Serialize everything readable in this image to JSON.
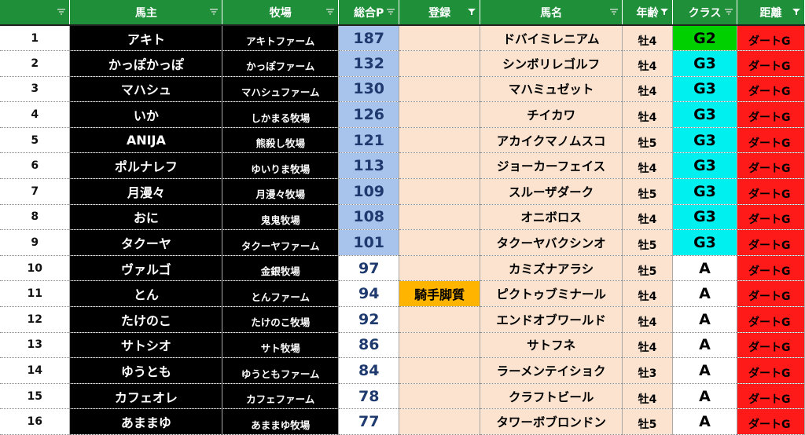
{
  "headers": [
    {
      "label": "",
      "filter": "funnel-plain"
    },
    {
      "label": "馬主",
      "filter": "funnel-plain"
    },
    {
      "label": "牧場",
      "filter": "funnel-plain"
    },
    {
      "label": "総合P",
      "filter": "funnel-plain"
    },
    {
      "label": "登録",
      "filter": "funnel-active"
    },
    {
      "label": "馬名",
      "filter": "funnel-plain"
    },
    {
      "label": "年齢",
      "filter": "funnel-active"
    },
    {
      "label": "クラス",
      "filter": "funnel-plain"
    },
    {
      "label": "距離",
      "filter": "funnel-active"
    }
  ],
  "colors": {
    "header": "#1f8f3a",
    "owner_bg": "#000000",
    "points_highlight": "#a9c4ec",
    "peach": "#fbe3cf",
    "g2": "#00d000",
    "g3": "#00f0f0",
    "dist": "#ff1a1a",
    "jockey": "#ffb400"
  },
  "rows": [
    {
      "num": "1",
      "owner": "アキト",
      "farm": "アキトファーム",
      "points": "187",
      "reg": "",
      "horse": "ドバイミレニアム",
      "age": "牡4",
      "cls": "G2",
      "dist": "ダートG"
    },
    {
      "num": "2",
      "owner": "かっぽかっぽ",
      "farm": "かっぽファーム",
      "points": "132",
      "reg": "",
      "horse": "シンボリレゴルフ",
      "age": "牡4",
      "cls": "G3",
      "dist": "ダートG"
    },
    {
      "num": "3",
      "owner": "マハシュ",
      "farm": "マハシュファーム",
      "points": "130",
      "reg": "",
      "horse": "マハミュゼット",
      "age": "牡4",
      "cls": "G3",
      "dist": "ダートG"
    },
    {
      "num": "4",
      "owner": "いか",
      "farm": "しかまる牧場",
      "points": "126",
      "reg": "",
      "horse": "チイカワ",
      "age": "牡4",
      "cls": "G3",
      "dist": "ダートG"
    },
    {
      "num": "5",
      "owner": "ANIJA",
      "farm": "熊殺し牧場",
      "points": "121",
      "reg": "",
      "horse": "アカイクマノムスコ",
      "age": "牡5",
      "cls": "G3",
      "dist": "ダートG"
    },
    {
      "num": "6",
      "owner": "ポルナレフ",
      "farm": "ゆいりま牧場",
      "points": "113",
      "reg": "",
      "horse": "ジョーカーフェイス",
      "age": "牡4",
      "cls": "G3",
      "dist": "ダートG"
    },
    {
      "num": "7",
      "owner": "月漫々",
      "farm": "月漫々牧場",
      "points": "109",
      "reg": "",
      "horse": "スルーザダーク",
      "age": "牡5",
      "cls": "G3",
      "dist": "ダートG"
    },
    {
      "num": "8",
      "owner": "おに",
      "farm": "鬼鬼牧場",
      "points": "108",
      "reg": "",
      "horse": "オニボロス",
      "age": "牡4",
      "cls": "G3",
      "dist": "ダートG"
    },
    {
      "num": "9",
      "owner": "タクーヤ",
      "farm": "タクーヤファーム",
      "points": "101",
      "reg": "",
      "horse": "タクーヤバクシンオ",
      "age": "牡5",
      "cls": "G3",
      "dist": "ダートG"
    },
    {
      "num": "10",
      "owner": "ヴァルゴ",
      "farm": "金銀牧場",
      "points": "97",
      "reg": "",
      "horse": "カミズナアラシ",
      "age": "牡5",
      "cls": "A",
      "dist": "ダートG"
    },
    {
      "num": "11",
      "owner": "とん",
      "farm": "とんファーム",
      "points": "94",
      "reg": "騎手脚質",
      "horse": "ピクトゥブミナール",
      "age": "牡4",
      "cls": "A",
      "dist": "ダートG"
    },
    {
      "num": "12",
      "owner": "たけのこ",
      "farm": "たけのこ牧場",
      "points": "92",
      "reg": "",
      "horse": "エンドオブワールド",
      "age": "牡4",
      "cls": "A",
      "dist": "ダートG"
    },
    {
      "num": "13",
      "owner": "サトシオ",
      "farm": "サト牧場",
      "points": "86",
      "reg": "",
      "horse": "サトフネ",
      "age": "牡4",
      "cls": "A",
      "dist": "ダートG"
    },
    {
      "num": "14",
      "owner": "ゆうとも",
      "farm": "ゆうともファーム",
      "points": "84",
      "reg": "",
      "horse": "ラーメンテイショク",
      "age": "牡3",
      "cls": "A",
      "dist": "ダートG"
    },
    {
      "num": "15",
      "owner": "カフェオレ",
      "farm": "カフェファーム",
      "points": "78",
      "reg": "",
      "horse": "クラフトビール",
      "age": "牡4",
      "cls": "A",
      "dist": "ダートG"
    },
    {
      "num": "16",
      "owner": "あままゆ",
      "farm": "あままゆ牧場",
      "points": "77",
      "reg": "",
      "horse": "タワーボブロンドン",
      "age": "牡5",
      "cls": "A",
      "dist": "ダートG"
    }
  ]
}
